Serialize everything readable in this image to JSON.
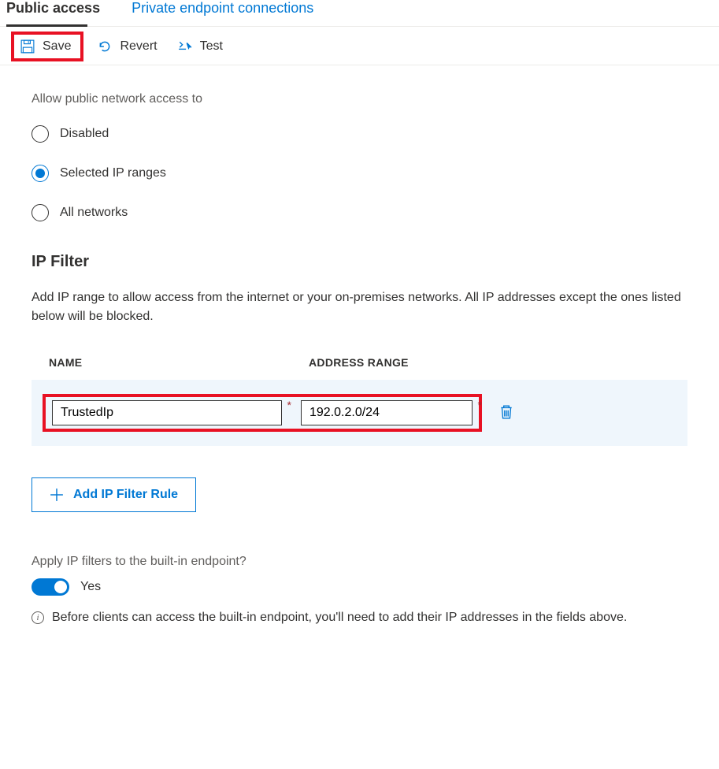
{
  "tabs": [
    {
      "label": "Public access",
      "active": true
    },
    {
      "label": "Private endpoint connections",
      "active": false
    }
  ],
  "toolbar": {
    "save_label": "Save",
    "revert_label": "Revert",
    "test_label": "Test"
  },
  "access": {
    "heading": "Allow public network access to",
    "options": [
      {
        "label": "Disabled",
        "selected": false
      },
      {
        "label": "Selected IP ranges",
        "selected": true
      },
      {
        "label": "All networks",
        "selected": false
      }
    ]
  },
  "ipfilter": {
    "title": "IP Filter",
    "description": "Add IP range to allow access from the internet or your on-premises networks. All IP addresses except the ones listed below will be blocked.",
    "columns": {
      "name": "NAME",
      "addr": "ADDRESS RANGE"
    },
    "rows": [
      {
        "name": "TrustedIp",
        "addr": "192.0.2.0/24"
      }
    ],
    "add_button": "Add IP Filter Rule"
  },
  "builtin": {
    "label": "Apply IP filters to the built-in endpoint?",
    "toggle_value": "Yes",
    "toggle_on": true,
    "info": "Before clients can access the built-in endpoint, you'll need to add their IP addresses in the fields above."
  },
  "colors": {
    "primary": "#0078d4",
    "highlight": "#e81123",
    "row_bg": "#eff6fc"
  }
}
